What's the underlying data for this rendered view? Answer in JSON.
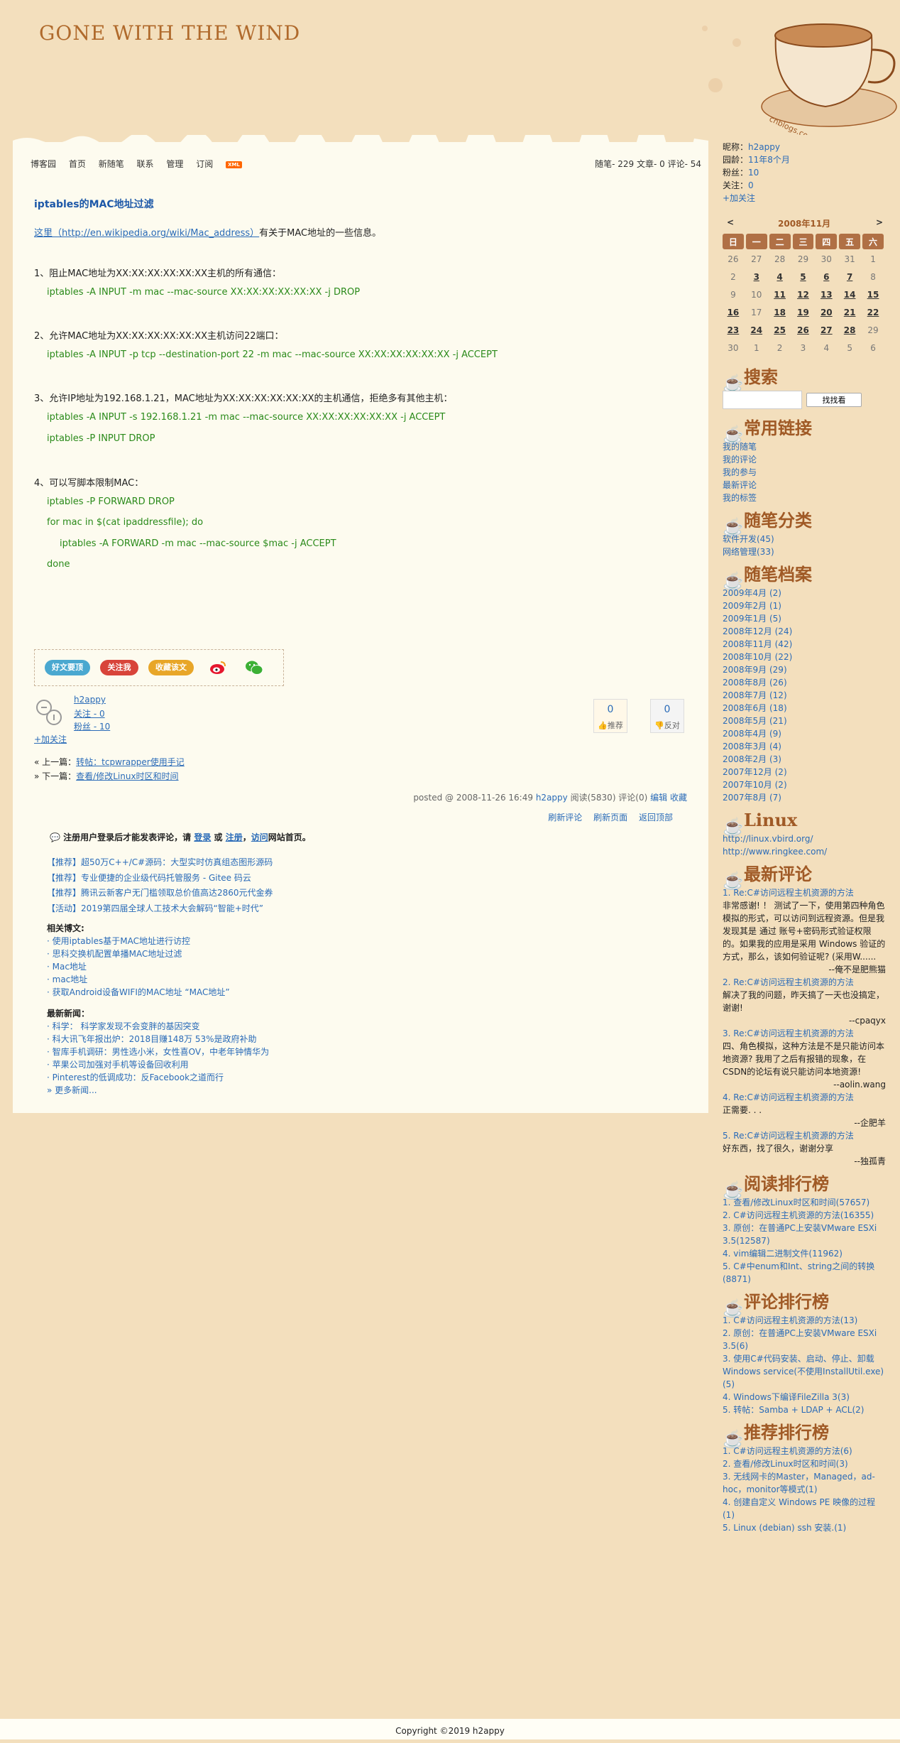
{
  "blog": {
    "title": "GONE WITH THE WIND",
    "watermark": "cnblogs.com"
  },
  "nav": {
    "items": [
      "博客园",
      "首页",
      "新随笔",
      "联系",
      "管理",
      "订阅"
    ],
    "xml": "XML",
    "stats": "随笔- 229  文章- 0  评论- 54"
  },
  "post": {
    "title": "iptables的MAC地址过滤",
    "intro_link": "这里（http://en.wikipedia.org/wiki/Mac_address）",
    "intro_rest": "有关于MAC地址的一些信息。",
    "s1": "1、阻止MAC地址为XX:XX:XX:XX:XX:XX主机的所有通信：",
    "c1": "iptables -A INPUT -m mac --mac-source XX:XX:XX:XX:XX:XX -j DROP",
    "s2": "2、允许MAC地址为XX:XX:XX:XX:XX:XX主机访问22端口：",
    "c2": "iptables -A INPUT -p tcp --destination-port 22 -m mac --mac-source XX:XX:XX:XX:XX:XX -j ACCEPT",
    "s3": "3、允许IP地址为192.168.1.21，MAC地址为XX:XX:XX:XX:XX:XX的主机通信，拒绝多有其他主机：",
    "c3a": "iptables -A INPUT -s 192.168.1.21 -m mac --mac-source XX:XX:XX:XX:XX:XX -j ACCEPT",
    "c3b": "iptables -P INPUT DROP",
    "s4": "4、可以写脚本限制MAC：",
    "c4a": "iptables -P FORWARD DROP",
    "c4b": "for mac in $(cat ipaddressfile); do",
    "c4c": "iptables -A FORWARD -m mac --mac-source $mac -j ACCEPT",
    "c4d": "done"
  },
  "share": {
    "recommend": "好文要顶",
    "follow": "关注我",
    "favorite": "收藏该文"
  },
  "author": {
    "name": "h2appy",
    "following": "关注 - 0",
    "fans": "粉丝 - 10",
    "add_follow": "+加关注",
    "digg_count": "0",
    "digg_label": "推荐",
    "bury_count": "0",
    "bury_label": "反对"
  },
  "prevnext": {
    "prev_label": "« 上一篇：",
    "prev_link": "转帖：tcpwrapper使用手记",
    "next_label": "» 下一篇：",
    "next_link": "查看/修改Linux时区和时间"
  },
  "postinfo": {
    "prefix": "posted @ 2008-11-26 16:49",
    "author": "h2appy",
    "meta": "阅读(5830) 评论(0)",
    "edit": "编辑",
    "collect": "收藏"
  },
  "comment_tools": [
    "刷新评论",
    "刷新页面",
    "返回顶部"
  ],
  "login_notice": {
    "p1": "注册用户登录后才能发表评论，请",
    "login": "登录",
    "p2": "或",
    "register": "注册",
    "p3": "，",
    "visit": "访问",
    "p4": "网站首页。"
  },
  "ads": [
    "【推荐】超50万C++/C#源码：大型实时仿真组态图形源码",
    "【推荐】专业便捷的企业级代码托管服务 - Gitee 码云",
    "【推荐】腾讯云新客户无门槛领取总价值高达2860元代金券",
    "【活动】2019第四届全球人工技术大会解码“智能+时代”"
  ],
  "related": {
    "title": "相关博文:",
    "items": [
      "· 使用iptables基于MAC地址进行访控",
      "· 思科交换机配置单播MAC地址过滤",
      "· Mac地址",
      "· mac地址",
      "· 获取Android设备WIFI的MAC地址 “MAC地址”"
    ]
  },
  "news": {
    "title": "最新新闻：",
    "items": [
      "· 科学：  科学家发现不会变胖的基因突变",
      "· 科大讯飞年报出炉：2018目赚148万 53%是政府补助",
      "· 智库手机调研：男性选小米，女性喜OV，中老年钟情华为",
      "· 苹果公司加强对手机等设备回收利用",
      "· Pinterest的低调成功：反Facebook之道而行"
    ],
    "more": "» 更多新闻..."
  },
  "profile": {
    "nick": "昵称：",
    "nick_v": "h2appy",
    "age": "园龄：",
    "age_v": "11年8个月",
    "fans": "粉丝：",
    "fans_v": "10",
    "follow": "关注：",
    "follow_v": "0",
    "add": "+加关注"
  },
  "calendar": {
    "prev": "<",
    "title": "2008年11月",
    "next": ">",
    "weekdays": [
      "日",
      "一",
      "二",
      "三",
      "四",
      "五",
      "六"
    ],
    "rows": [
      [
        "26",
        "27",
        "28",
        "29",
        "30",
        "31",
        "1"
      ],
      [
        "2",
        "3",
        "4",
        "5",
        "6",
        "7",
        "8"
      ],
      [
        "9",
        "10",
        "11",
        "12",
        "13",
        "14",
        "15"
      ],
      [
        "16",
        "17",
        "18",
        "19",
        "20",
        "21",
        "22"
      ],
      [
        "23",
        "24",
        "25",
        "26",
        "27",
        "28",
        "29"
      ],
      [
        "30",
        "1",
        "2",
        "3",
        "4",
        "5",
        "6"
      ]
    ],
    "linked": [
      "3",
      "4",
      "5",
      "6",
      "7",
      "11",
      "12",
      "13",
      "14",
      "15",
      "16",
      "18",
      "19",
      "20",
      "21",
      "22",
      "23",
      "24",
      "25",
      "26",
      "27",
      "28"
    ]
  },
  "search": {
    "title": "搜索",
    "button": "找找看"
  },
  "links": {
    "title": "常用链接",
    "items": [
      "我的随笔",
      "我的评论",
      "我的参与",
      "最新评论",
      "我的标签"
    ]
  },
  "categories": {
    "title": "随笔分类",
    "items": [
      "软件开发(45)",
      "网络管理(33)"
    ]
  },
  "archives": {
    "title": "随笔档案",
    "items": [
      "2009年4月 (2)",
      "2009年2月 (1)",
      "2009年1月 (5)",
      "2008年12月 (24)",
      "2008年11月 (42)",
      "2008年10月 (22)",
      "2008年9月 (29)",
      "2008年8月 (26)",
      "2008年7月 (12)",
      "2008年6月 (18)",
      "2008年5月 (21)",
      "2008年4月 (9)",
      "2008年3月 (4)",
      "2008年2月 (3)",
      "2007年12月 (2)",
      "2007年10月 (2)",
      "2007年8月 (7)"
    ]
  },
  "linux": {
    "title": "Linux",
    "items": [
      "http://linux.vbird.org/",
      "http://www.ringkee.com/"
    ]
  },
  "recent_comments": {
    "title": "最新评论",
    "items": [
      {
        "link": "1. Re:C#访问远程主机资源的方法",
        "text": "非常感谢! ！ 测试了一下，使用第四种角色模拟的形式，可以访问到远程资源。但是我发现其是 通过 账号+密码形式验证权限的。如果我的应用是采用 Windows 验证的方式，那么，该如何验证呢? (采用W......",
        "author": "--俺不是肥熊猫"
      },
      {
        "link": "2. Re:C#访问远程主机资源的方法",
        "text": "解决了我的问题，昨天搞了一天也没搞定，谢谢!",
        "author": "--cpaqyx"
      },
      {
        "link": "3. Re:C#访问远程主机资源的方法",
        "text": "四、角色模拟，这种方法是不是只能访问本地资源? 我用了之后有报错的现象，在CSDN的论坛有说只能访问本地资源!",
        "author": "--aolin.wang"
      },
      {
        "link": "4. Re:C#访问远程主机资源的方法",
        "text": "正需要. . .",
        "author": "--企肥羊"
      },
      {
        "link": "5. Re:C#访问远程主机资源的方法",
        "text": "好东西，找了很久，谢谢分享",
        "author": "--独孤青"
      }
    ]
  },
  "top_read": {
    "title": "阅读排行榜",
    "items": [
      "1. 查看/修改Linux时区和时间(57657)",
      "2. C#访问远程主机资源的方法(16355)",
      "3. 原创：在普通PC上安装VMware ESXi 3.5(12587)",
      "4. vim编辑二进制文件(11962)",
      "5. C#中enum和Int、string之间的转换(8871)"
    ]
  },
  "top_comment": {
    "title": "评论排行榜",
    "items": [
      "1. C#访问远程主机资源的方法(13)",
      "2. 原创：在普通PC上安装VMware ESXi 3.5(6)",
      "3. 使用C#代码安装、启动、停止、卸载Windows service(不使用InstallUtil.exe)(5)",
      "4. Windows下编译FileZilla 3(3)",
      "5. 转帖：Samba + LDAP + ACL(2)"
    ]
  },
  "top_digg": {
    "title": "推荐排行榜",
    "items": [
      "1. C#访问远程主机资源的方法(6)",
      "2. 查看/修改Linux时区和时间(3)",
      "3. 无线网卡的Master，Managed，ad-hoc，monitor等模式(1)",
      "4. 创建自定义 Windows PE 映像的过程(1)",
      "5. Linux (debian) ssh 安装.(1)"
    ]
  },
  "footer": "Copyright ©2019 h2appy",
  "colors": {
    "bg": "#f3dfbd",
    "panel": "#fdfbef",
    "title": "#b06a2c",
    "link": "#2a6bb8",
    "code": "#2a8a1a"
  }
}
